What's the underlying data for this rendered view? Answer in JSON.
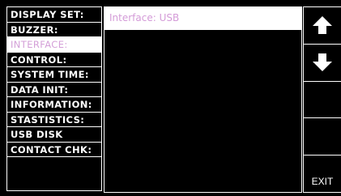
{
  "menu": {
    "items": [
      {
        "label": "DISPLAY SET:"
      },
      {
        "label": "BUZZER:"
      },
      {
        "label": "INTERFACE:"
      },
      {
        "label": "CONTROL:"
      },
      {
        "label": "SYSTEM TIME:"
      },
      {
        "label": "DATA INIT:"
      },
      {
        "label": "INFORMATION:"
      },
      {
        "label": "STASTISTICS:"
      },
      {
        "label": "USB DISK"
      },
      {
        "label": "CONTACT CHK:"
      }
    ],
    "selected_index": 2
  },
  "panel": {
    "header": "Interface: USB"
  },
  "softkeys": {
    "up_icon": "arrow-up-icon",
    "down_icon": "arrow-down-icon",
    "exit_label": "EXIT"
  },
  "colors": {
    "background": "#000000",
    "foreground": "#ffffff",
    "highlight_text": "#d49bd8"
  }
}
